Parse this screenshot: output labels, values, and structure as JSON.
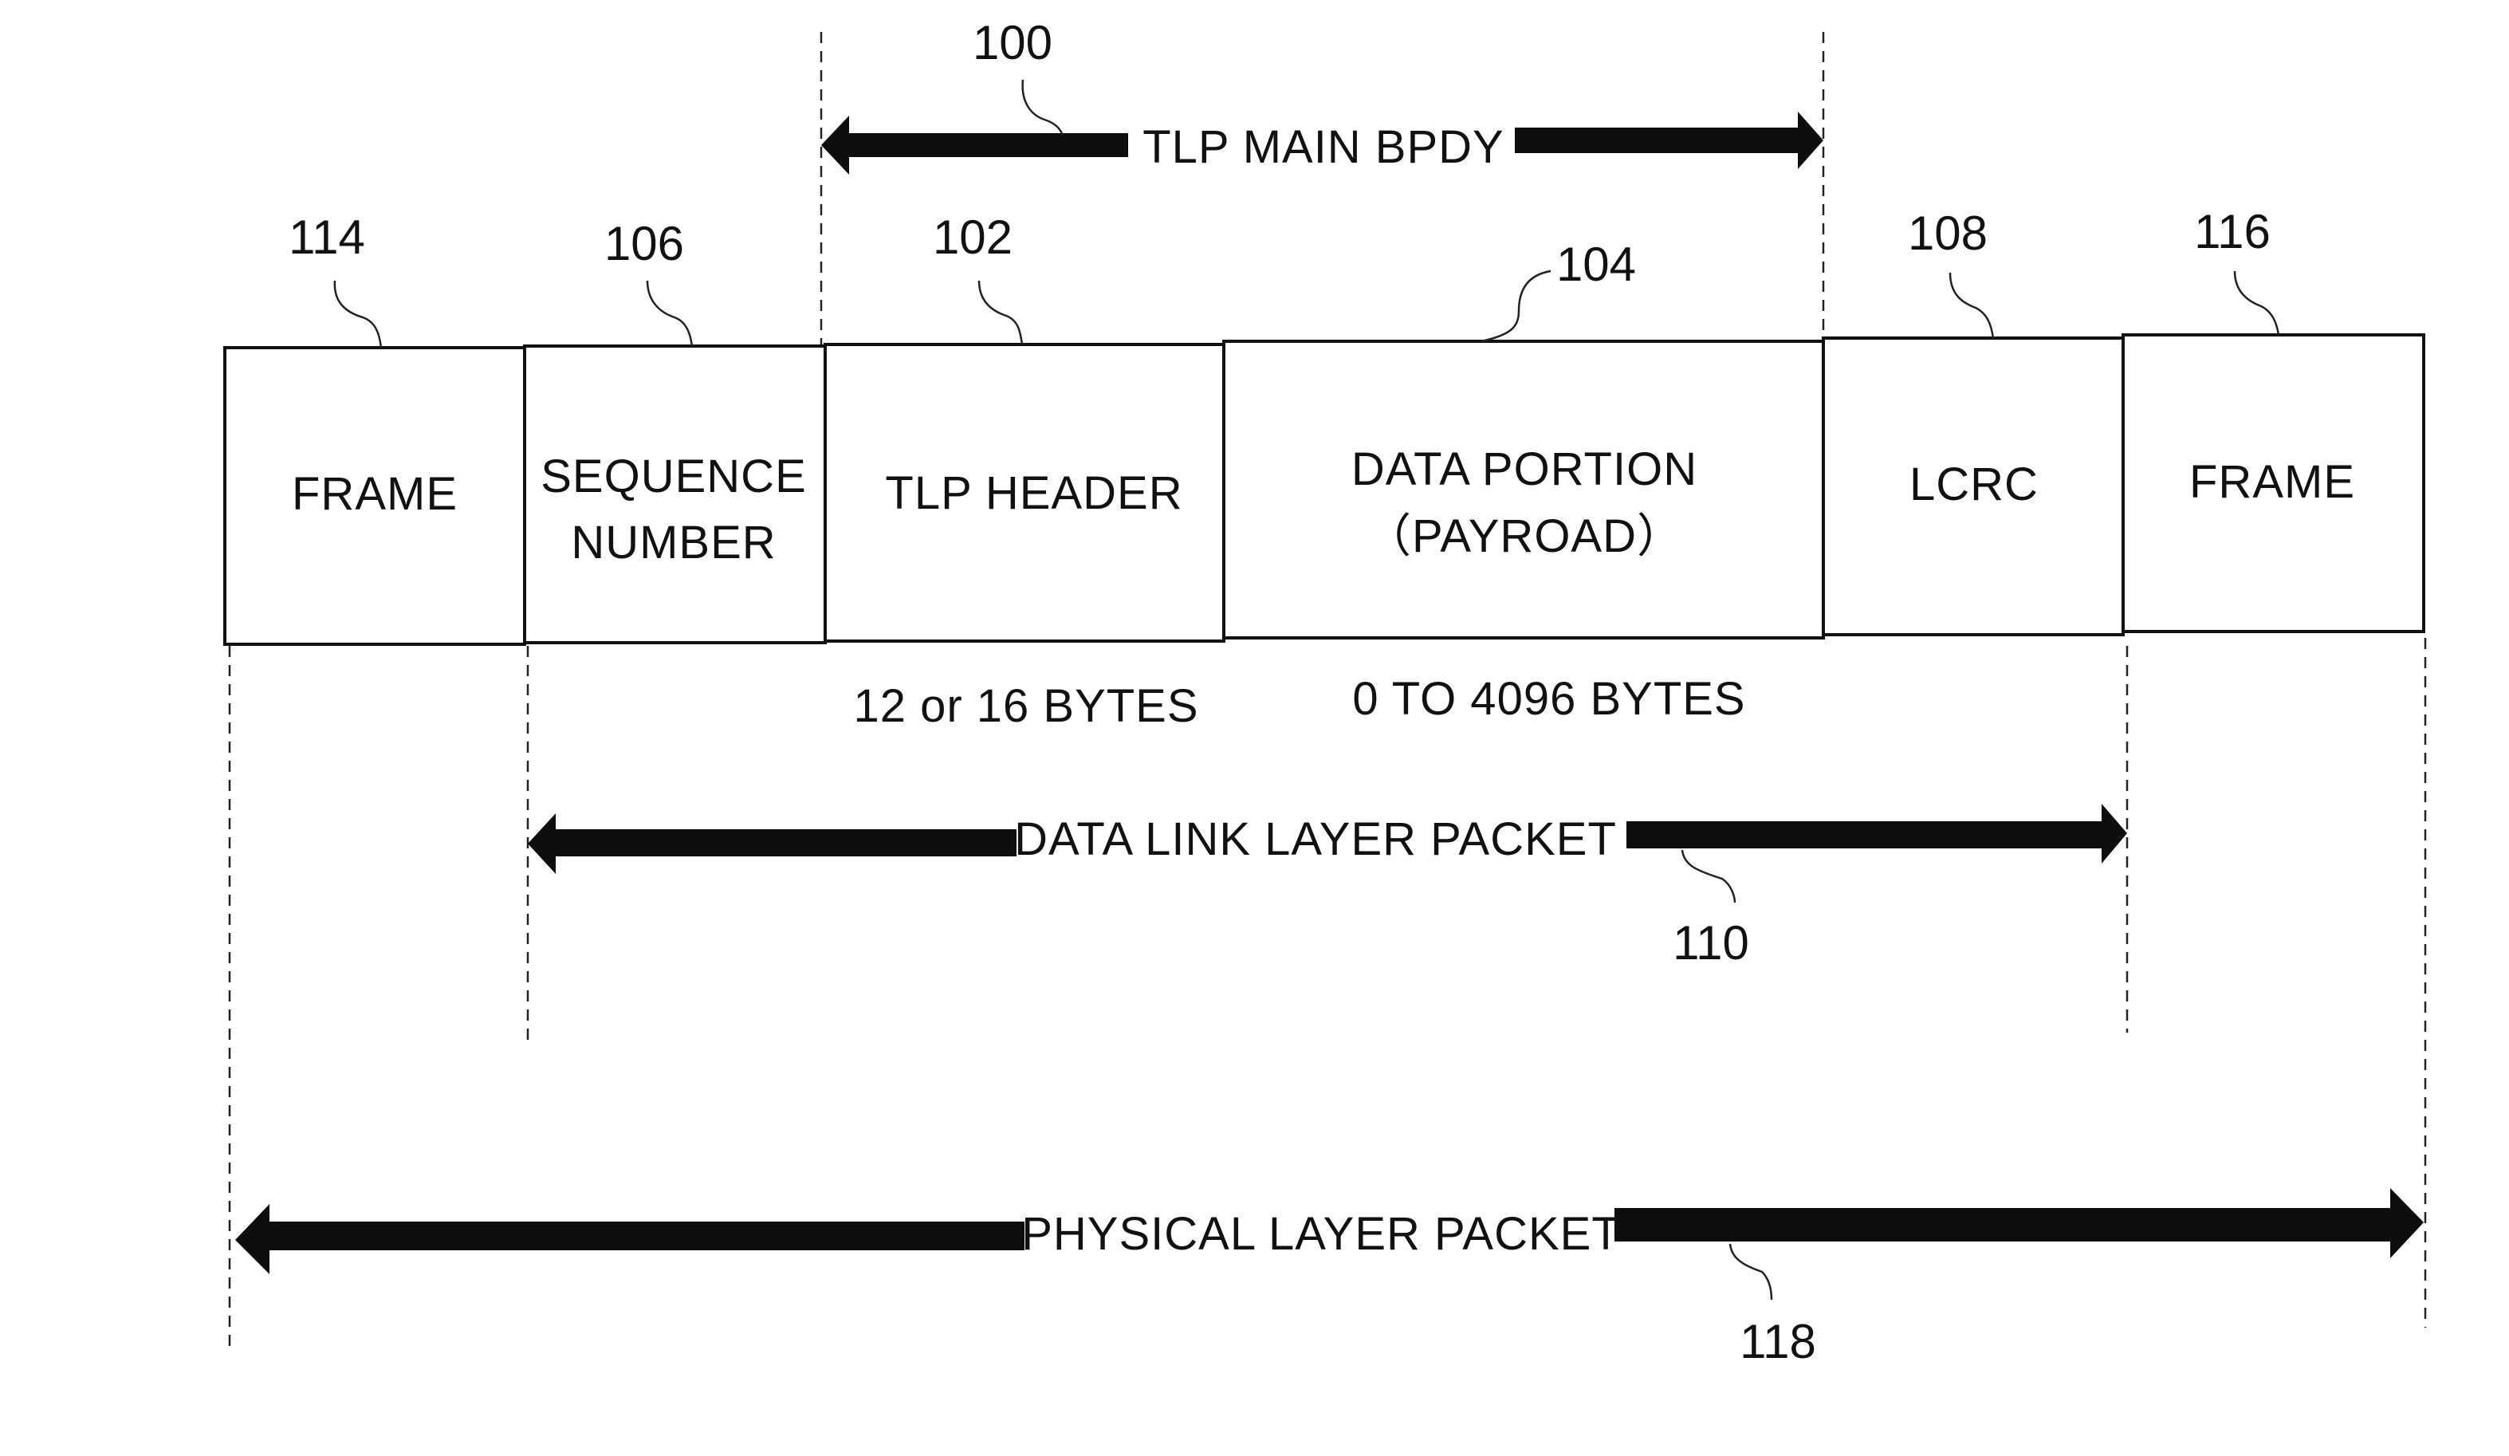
{
  "figure": {
    "tlp_arrow": {
      "label": "TLP MAIN BPDY",
      "ref": "100"
    },
    "fields": [
      {
        "label_lines": [
          "FRAME"
        ],
        "ref": "114"
      },
      {
        "label_lines": [
          "SEQUENCE",
          "NUMBER"
        ],
        "ref": "106"
      },
      {
        "label_lines": [
          "TLP HEADER"
        ],
        "ref": "102"
      },
      {
        "label_lines": [
          "DATA PORTION",
          "（PAYROAD）"
        ],
        "ref": "104"
      },
      {
        "label_lines": [
          "LCRC"
        ],
        "ref": "108"
      },
      {
        "label_lines": [
          "FRAME"
        ],
        "ref": "116"
      }
    ],
    "size_labels": {
      "header": "12 or 16 BYTES",
      "payload": "0 TO 4096 BYTES"
    },
    "data_link_arrow": {
      "label": "DATA LINK LAYER PACKET",
      "ref": "110"
    },
    "physical_arrow": {
      "label": "PHYSICAL LAYER PACKET",
      "ref": "118"
    }
  }
}
